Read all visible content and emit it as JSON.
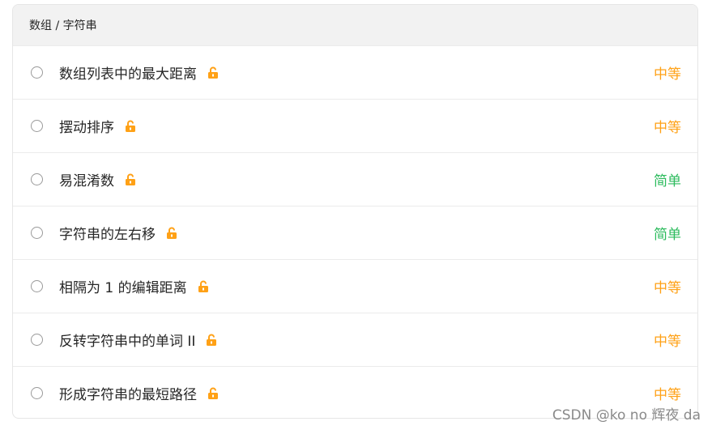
{
  "header": {
    "breadcrumb": "数组 / 字符串"
  },
  "colors": {
    "medium": "#ffa116",
    "easy": "#2cbb5d",
    "lock": "#ffa116"
  },
  "problems": [
    {
      "title": "数组列表中的最大距离",
      "difficulty": "中等",
      "level": "medium",
      "icon": "unlock-icon"
    },
    {
      "title": "摆动排序",
      "difficulty": "中等",
      "level": "medium",
      "icon": "unlock-icon"
    },
    {
      "title": "易混淆数",
      "difficulty": "简单",
      "level": "easy",
      "icon": "unlock-icon"
    },
    {
      "title": "字符串的左右移",
      "difficulty": "简单",
      "level": "easy",
      "icon": "unlock-icon"
    },
    {
      "title": "相隔为 1 的编辑距离",
      "difficulty": "中等",
      "level": "medium",
      "icon": "unlock-icon"
    },
    {
      "title": "反转字符串中的单词 II",
      "difficulty": "中等",
      "level": "medium",
      "icon": "unlock-icon"
    },
    {
      "title": "形成字符串的最短路径",
      "difficulty": "中等",
      "level": "medium",
      "icon": "unlock-icon"
    }
  ],
  "watermark": "CSDN @ko no 辉夜 da"
}
